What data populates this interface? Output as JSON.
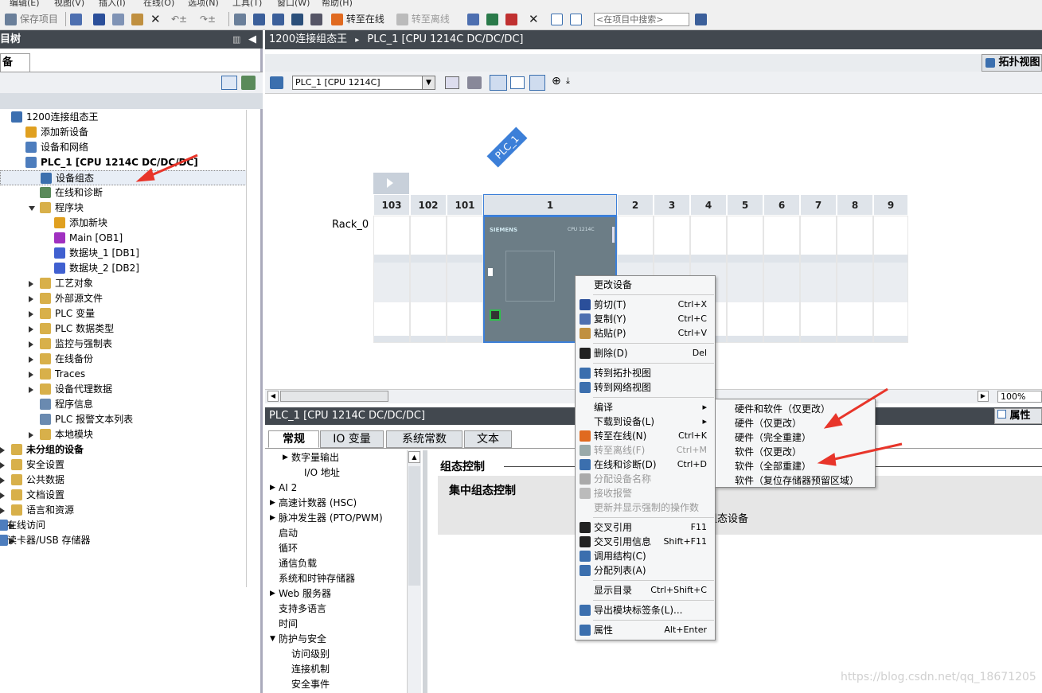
{
  "menubar": {
    "items": [
      "编辑(E)",
      "视图(V)",
      "插入(I)",
      "在线(O)",
      "选项(N)",
      "工具(T)",
      "窗口(W)",
      "帮助(H)"
    ]
  },
  "toolbar": {
    "save": "保存项目",
    "go_online": "转至在线",
    "go_offline": "转至离线",
    "search_placeholder": "<在项目中搜索>"
  },
  "left": {
    "header": "目树",
    "tab": "备",
    "tree": [
      {
        "label": "1200连接组态王",
        "indent": 0,
        "arrow": "none",
        "icon": "#3c6fb0",
        "bold": false
      },
      {
        "label": "添加新设备",
        "indent": 1,
        "arrow": "none",
        "icon": "#e0a020",
        "bold": false
      },
      {
        "label": "设备和网络",
        "indent": 1,
        "arrow": "none",
        "icon": "#4d7dbd",
        "bold": false
      },
      {
        "label": "PLC_1 [CPU 1214C DC/DC/DC]",
        "indent": 1,
        "arrow": "none",
        "icon": "#4d7dbd",
        "bold": true
      },
      {
        "label": "设备组态",
        "indent": 2,
        "arrow": "none",
        "icon": "#3b6fae",
        "bold": false
      },
      {
        "label": "在线和诊断",
        "indent": 2,
        "arrow": "none",
        "icon": "#5a8a5a",
        "bold": false
      },
      {
        "label": "程序块",
        "indent": 2,
        "arrow": "down",
        "icon": "#d8b04a",
        "bold": false
      },
      {
        "label": "添加新块",
        "indent": 3,
        "arrow": "none",
        "icon": "#e0a020",
        "bold": false
      },
      {
        "label": "Main [OB1]",
        "indent": 3,
        "arrow": "none",
        "icon": "#a030c0",
        "bold": false
      },
      {
        "label": "数据块_1 [DB1]",
        "indent": 3,
        "arrow": "none",
        "icon": "#4060d0",
        "bold": false
      },
      {
        "label": "数据块_2 [DB2]",
        "indent": 3,
        "arrow": "none",
        "icon": "#4060d0",
        "bold": false
      },
      {
        "label": "工艺对象",
        "indent": 2,
        "arrow": "right",
        "icon": "#d8b04a",
        "bold": false
      },
      {
        "label": "外部源文件",
        "indent": 2,
        "arrow": "right",
        "icon": "#d8b04a",
        "bold": false
      },
      {
        "label": "PLC 变量",
        "indent": 2,
        "arrow": "right",
        "icon": "#d8b04a",
        "bold": false
      },
      {
        "label": "PLC 数据类型",
        "indent": 2,
        "arrow": "right",
        "icon": "#d8b04a",
        "bold": false
      },
      {
        "label": "监控与强制表",
        "indent": 2,
        "arrow": "right",
        "icon": "#d8b04a",
        "bold": false
      },
      {
        "label": "在线备份",
        "indent": 2,
        "arrow": "right",
        "icon": "#d8b04a",
        "bold": false
      },
      {
        "label": "Traces",
        "indent": 2,
        "arrow": "right",
        "icon": "#d8b04a",
        "bold": false
      },
      {
        "label": "设备代理数据",
        "indent": 2,
        "arrow": "right",
        "icon": "#d8b04a",
        "bold": false
      },
      {
        "label": "程序信息",
        "indent": 2,
        "arrow": "none",
        "icon": "#6a8ab0",
        "bold": false
      },
      {
        "label": "PLC 报警文本列表",
        "indent": 2,
        "arrow": "none",
        "icon": "#6a8ab0",
        "bold": false
      },
      {
        "label": "本地模块",
        "indent": 2,
        "arrow": "right",
        "icon": "#d8b04a",
        "bold": false
      },
      {
        "label": "未分组的设备",
        "indent": 0,
        "arrow": "right",
        "icon": "#d8b04a",
        "bold": true
      },
      {
        "label": "安全设置",
        "indent": 0,
        "arrow": "right",
        "icon": "#d8b04a",
        "bold": false
      },
      {
        "label": "公共数据",
        "indent": 0,
        "arrow": "right",
        "icon": "#d8b04a",
        "bold": false
      },
      {
        "label": "文档设置",
        "indent": 0,
        "arrow": "right",
        "icon": "#d8b04a",
        "bold": false
      },
      {
        "label": "语言和资源",
        "indent": 0,
        "arrow": "right",
        "icon": "#d8b04a",
        "bold": false
      },
      {
        "label": "在线访问",
        "indent": -1,
        "arrow": "right",
        "icon": "#4d7dbd",
        "bold": false
      },
      {
        "label": "读卡器/USB 存储器",
        "indent": -1,
        "arrow": "right",
        "icon": "#4d7dbd",
        "bold": false
      }
    ]
  },
  "breadcrumb": {
    "project": "1200连接组态王",
    "sep": "▸",
    "device": "PLC_1 [CPU 1214C DC/DC/DC]"
  },
  "topology_btn": "拓扑视图",
  "device_select": "PLC_1 [CPU 1214C]",
  "rack": {
    "label": "Rack_0",
    "plc_tag": "PLC_1",
    "slots": [
      "103",
      "102",
      "101",
      "1",
      "2",
      "3",
      "4",
      "5",
      "6",
      "7",
      "8",
      "9"
    ],
    "cpu_brand": "SIEMENS",
    "cpu_model": "CPU 1214C"
  },
  "zoom": "100%",
  "props": {
    "header": "PLC_1 [CPU 1214C DC/DC/DC]",
    "properties_tab": "属性",
    "tabs": [
      "常规",
      "IO 变量",
      "系统常数",
      "文本"
    ],
    "list": [
      {
        "label": "数字量输出",
        "indent": 1,
        "arrow": "right"
      },
      {
        "label": "I/O 地址",
        "indent": 2,
        "arrow": "none"
      },
      {
        "label": "AI 2",
        "indent": 0,
        "arrow": "right"
      },
      {
        "label": "高速计数器 (HSC)",
        "indent": 0,
        "arrow": "right"
      },
      {
        "label": "脉冲发生器 (PTO/PWM)",
        "indent": 0,
        "arrow": "right"
      },
      {
        "label": "启动",
        "indent": 0,
        "arrow": "none"
      },
      {
        "label": "循环",
        "indent": 0,
        "arrow": "none"
      },
      {
        "label": "通信负载",
        "indent": 0,
        "arrow": "none"
      },
      {
        "label": "系统和时钟存储器",
        "indent": 0,
        "arrow": "none"
      },
      {
        "label": "Web 服务器",
        "indent": 0,
        "arrow": "right"
      },
      {
        "label": "支持多语言",
        "indent": 0,
        "arrow": "none"
      },
      {
        "label": "时间",
        "indent": 0,
        "arrow": "none"
      },
      {
        "label": "防护与安全",
        "indent": 0,
        "arrow": "down"
      },
      {
        "label": "访问级别",
        "indent": 1,
        "arrow": "none"
      },
      {
        "label": "连接机制",
        "indent": 1,
        "arrow": "none"
      },
      {
        "label": "安全事件",
        "indent": 1,
        "arrow": "none"
      }
    ],
    "section_title": "组态控制",
    "box_title": "集中组态控制",
    "box_text_tail": "组态设备"
  },
  "context_menu": [
    {
      "label": "更改设备",
      "key": "",
      "icon": "",
      "dis": false
    },
    {
      "sep": true
    },
    {
      "label": "剪切(T)",
      "key": "Ctrl+X",
      "icon": "#2b4f9a",
      "dis": false
    },
    {
      "label": "复制(Y)",
      "key": "Ctrl+C",
      "icon": "#4d6fb0",
      "dis": false
    },
    {
      "label": "粘贴(P)",
      "key": "Ctrl+V",
      "icon": "#c09040",
      "dis": false
    },
    {
      "sep": true
    },
    {
      "label": "删除(D)",
      "key": "Del",
      "icon": "#222",
      "dis": false
    },
    {
      "sep": true
    },
    {
      "label": "转到拓扑视图",
      "key": "",
      "icon": "#3b6fae",
      "dis": false
    },
    {
      "label": "转到网络视图",
      "key": "",
      "icon": "#3b6fae",
      "dis": false
    },
    {
      "sep": true
    },
    {
      "label": "编译",
      "key": "▸",
      "icon": "",
      "dis": false
    },
    {
      "label": "下载到设备(L)",
      "key": "▸",
      "icon": "",
      "dis": false
    },
    {
      "label": "转至在线(N)",
      "key": "Ctrl+K",
      "icon": "#e06a20",
      "dis": false
    },
    {
      "label": "转至离线(F)",
      "key": "Ctrl+M",
      "icon": "#9aa",
      "dis": true
    },
    {
      "label": "在线和诊断(D)",
      "key": "Ctrl+D",
      "icon": "#3b6fae",
      "dis": false
    },
    {
      "label": "分配设备名称",
      "key": "",
      "icon": "#aaa",
      "dis": true
    },
    {
      "label": "接收报警",
      "key": "",
      "icon": "#bbb",
      "dis": true
    },
    {
      "label": "更新并显示强制的操作数",
      "key": "",
      "icon": "",
      "dis": true
    },
    {
      "sep": true
    },
    {
      "label": "交叉引用",
      "key": "F11",
      "icon": "#222",
      "dis": false
    },
    {
      "label": "交叉引用信息",
      "key": "Shift+F11",
      "icon": "#222",
      "dis": false
    },
    {
      "label": "调用结构(C)",
      "key": "",
      "icon": "#3b6fae",
      "dis": false
    },
    {
      "label": "分配列表(A)",
      "key": "",
      "icon": "#3b6fae",
      "dis": false
    },
    {
      "sep": true
    },
    {
      "label": "显示目录",
      "key": "Ctrl+Shift+C",
      "icon": "",
      "dis": false
    },
    {
      "sep": true
    },
    {
      "label": "导出模块标签条(L)...",
      "key": "",
      "icon": "#3b6fae",
      "dis": false
    },
    {
      "sep": true
    },
    {
      "label": "属性",
      "key": "Alt+Enter",
      "icon": "#3b6fae",
      "dis": false
    }
  ],
  "submenu": [
    "硬件和软件（仅更改）",
    "硬件（仅更改）",
    "硬件（完全重建）",
    "软件（仅更改）",
    "软件（全部重建）",
    "软件（复位存储器预留区域）"
  ],
  "watermark": "https://blog.csdn.net/qq_18671205",
  "colors": {
    "annotation_arrow": "#e8352a",
    "selection": "#3c7fd8",
    "header": "#42484f"
  }
}
